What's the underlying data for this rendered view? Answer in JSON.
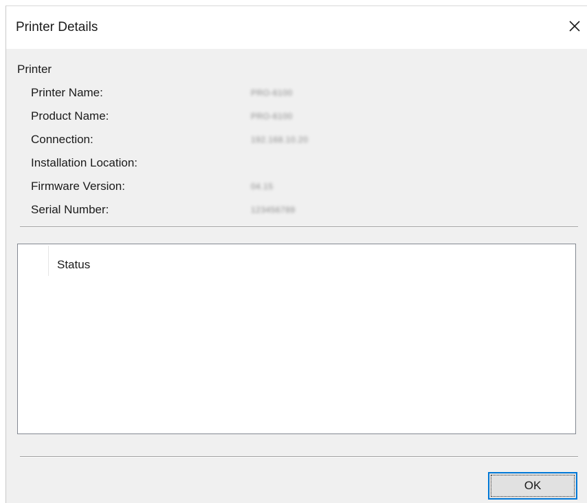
{
  "window": {
    "title": "Printer Details",
    "close_icon": "close-icon"
  },
  "printer": {
    "section_label": "Printer",
    "fields": [
      {
        "label": "Printer Name:",
        "value": "PRO-6100"
      },
      {
        "label": "Product Name:",
        "value": "PRO-6100"
      },
      {
        "label": "Connection:",
        "value": "192.168.10.20"
      },
      {
        "label": "Installation Location:",
        "value": ""
      },
      {
        "label": "Firmware Version:",
        "value": "04.15"
      },
      {
        "label": "Serial Number:",
        "value": "123456789"
      }
    ]
  },
  "status_panel": {
    "column_header": "Status"
  },
  "footer": {
    "ok_label": "OK"
  },
  "colors": {
    "accent": "#0078d7",
    "dialog_background": "#f0f0f0"
  }
}
